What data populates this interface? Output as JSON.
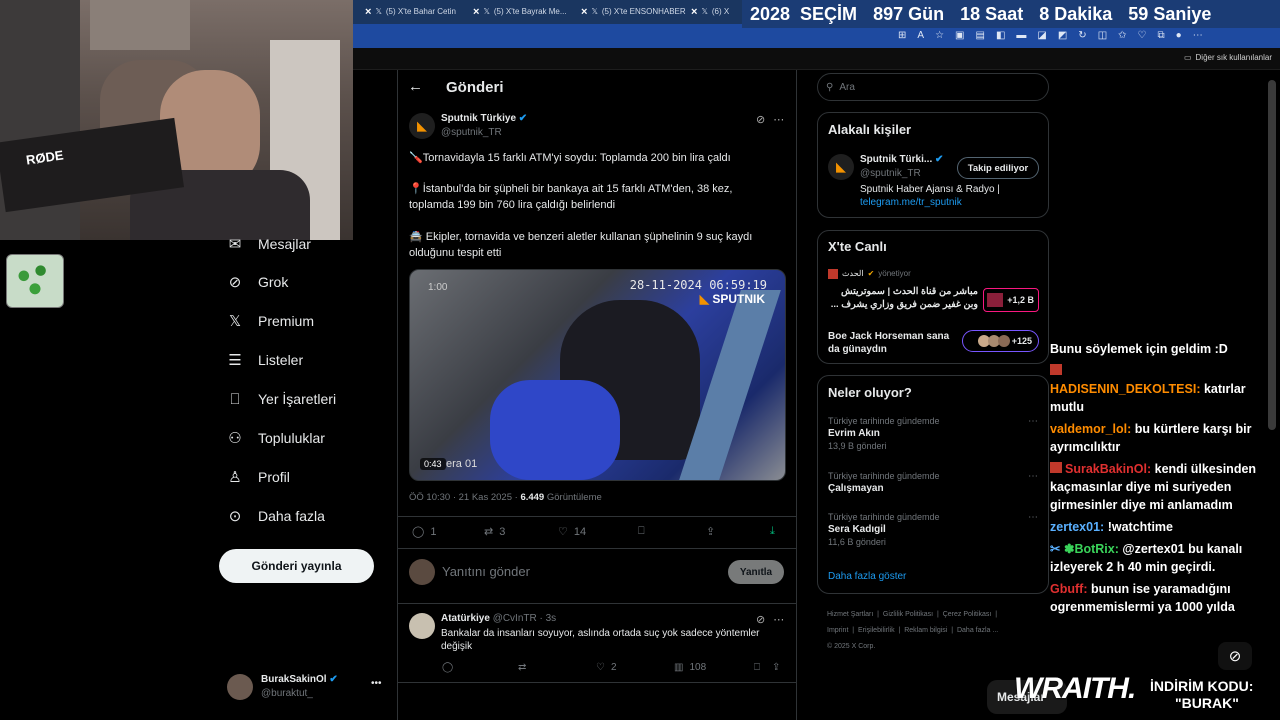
{
  "browser": {
    "tabs": [
      {
        "label": "(5) X'te Bahar Cetin"
      },
      {
        "label": "(5) X'te Bayrak Me..."
      },
      {
        "label": "(5) X'te ENSONHABER"
      },
      {
        "label": "(6) X"
      }
    ],
    "bookmarks_label": "Diğer sık kullanılanlar"
  },
  "countdown": {
    "year": "2028",
    "title": "SEÇİM",
    "days": "897",
    "days_label": "Gün",
    "hours": "18",
    "hours_label": "Saat",
    "minutes": "8",
    "minutes_label": "Dakika",
    "seconds": "59",
    "seconds_label": "Saniye"
  },
  "webcam": {
    "mic_label": "RØDE"
  },
  "sidebar": {
    "items": [
      {
        "label": "Mesajlar",
        "icon": "mail-icon"
      },
      {
        "label": "Grok",
        "icon": "grok-icon"
      },
      {
        "label": "Premium",
        "icon": "x-icon"
      },
      {
        "label": "Listeler",
        "icon": "list-icon"
      },
      {
        "label": "Yer İşaretleri",
        "icon": "bookmark-icon"
      },
      {
        "label": "Topluluklar",
        "icon": "communities-icon"
      },
      {
        "label": "Profil",
        "icon": "profile-icon"
      },
      {
        "label": "Daha fazla",
        "icon": "more-icon"
      }
    ],
    "post_button": "Gönderi yayınla",
    "account": {
      "name": "BurakSakinOl",
      "handle": "@buraktut_",
      "more": "•••"
    }
  },
  "main": {
    "header": {
      "back": "←",
      "title": "Gönderi"
    },
    "post": {
      "author": "Sputnik Türkiye",
      "handle": "@sputnik_TR",
      "line1": "Tornavidayla 15 farklı ATM'yi soydu: Toplamda 200 bin lira çaldı",
      "line2": "İstanbul'da bir şüpheli bir bankaya ait 15 farklı ATM'den, 38 kez, toplamda 199 bin 760 lira çaldığı belirlendi",
      "line3": "Ekipler, tornavida ve benzeri aletler kullanan şüphelinin 9 suç kaydı olduğunu tespit etti",
      "video": {
        "timestamp": "28-11-2024 06:59:19",
        "logo": "SPUTNIK",
        "corner": "1:00",
        "duration": "0:43",
        "caption": "era 01"
      },
      "meta_time": "ÖÖ 10:30 · 21 Kas 2025 · ",
      "views": "6.449",
      "views_label": "Görüntüleme",
      "actions": {
        "replies": "1",
        "reposts": "3",
        "likes": "14"
      }
    },
    "reply_box": {
      "placeholder": "Yanıtını gönder",
      "button": "Yanıtla"
    },
    "reply": {
      "author": "Atatürkiye",
      "handle": "@CvInTR · 3s",
      "text": "Bankalar da insanları soyuyor, aslında ortada suç yok sadece yöntemler değişik",
      "actions": {
        "replies": "",
        "reposts": "",
        "likes": "2",
        "views": "108"
      }
    }
  },
  "right": {
    "search_placeholder": "Ara",
    "relevant": {
      "title": "Alakalı kişiler",
      "name": "Sputnik Türki...",
      "handle": "@sputnik_TR",
      "follow": "Takip ediliyor",
      "bio": "Sputnik Haber Ajansı & Radyo |",
      "link": "telegram.me/tr_sputnik"
    },
    "live": {
      "title": "X'te Canlı",
      "item1_host": "الحدث",
      "item1_role": "yönetiyor",
      "item1_text": "مباشر من قناة الحدث | سموتريتش وبن غفير ضمن فريق وزاري يشرف ...",
      "item1_count": "+1,2 B",
      "item2_text": "Boe Jack Horseman sana da günaydın",
      "item2_count": "+125"
    },
    "trends": {
      "title": "Neler oluyor?",
      "items": [
        {
          "meta": "Türkiye tarihinde gündemde",
          "name": "Evrim Akın",
          "count": "13,9 B gönderi"
        },
        {
          "meta": "Türkiye tarihinde gündemde",
          "name": "Çalışmayan",
          "count": ""
        },
        {
          "meta": "Türkiye tarihinde gündemde",
          "name": "Sera Kadıgil",
          "count": "11,6 B gönderi"
        }
      ],
      "show_more": "Daha fazla göster"
    },
    "footer": {
      "links": [
        "Hizmet Şartları",
        "Gizlilik Politikası",
        "Çerez Politikası",
        "Imprint",
        "Erişilebilirlik",
        "Reklam bilgisi",
        "Daha fazla ..."
      ],
      "copyright": "© 2025 X Corp."
    }
  },
  "chat": {
    "lines": [
      {
        "user": "",
        "text": "Bunu söylemek için geldim :D",
        "color": "#ffffff"
      },
      {
        "user": "HADISENIN_DEKOLTESI:",
        "text": "katırlar mutlu",
        "color": "#ff8c00"
      },
      {
        "user": "valdemor_lol:",
        "text": "bu kürtlere karşı bir ayrımcılıktır",
        "color": "#ff8c00"
      },
      {
        "user": "SurakBakinOl:",
        "text": "kendi ülkesinden kaçmasınlar diye mi suriyeden girmesinler diye mi anlamadım",
        "color": "#e03030"
      },
      {
        "user": "zertex01:",
        "text": "!watchtime",
        "color": "#5ab0ff"
      },
      {
        "user": "BotRix:",
        "text": "@zertex01 bu kanalı izleyerek 2 h 40 min geçirdi.",
        "color": "#3ad45a"
      },
      {
        "user": "Gbuff:",
        "text": "bunun ise yaramadığını ogrenmemislermi ya 1000 yılda",
        "color": "#e03030"
      }
    ]
  },
  "overlay": {
    "brand": "WRAITH.",
    "promo_label": "İNDİRİM KODU:",
    "promo_code": "\"BURAK\"",
    "msg_label": "Mesajlar"
  },
  "colors": {
    "accent": "#1d9bf0",
    "background": "#000000",
    "border": "#2f3336"
  }
}
